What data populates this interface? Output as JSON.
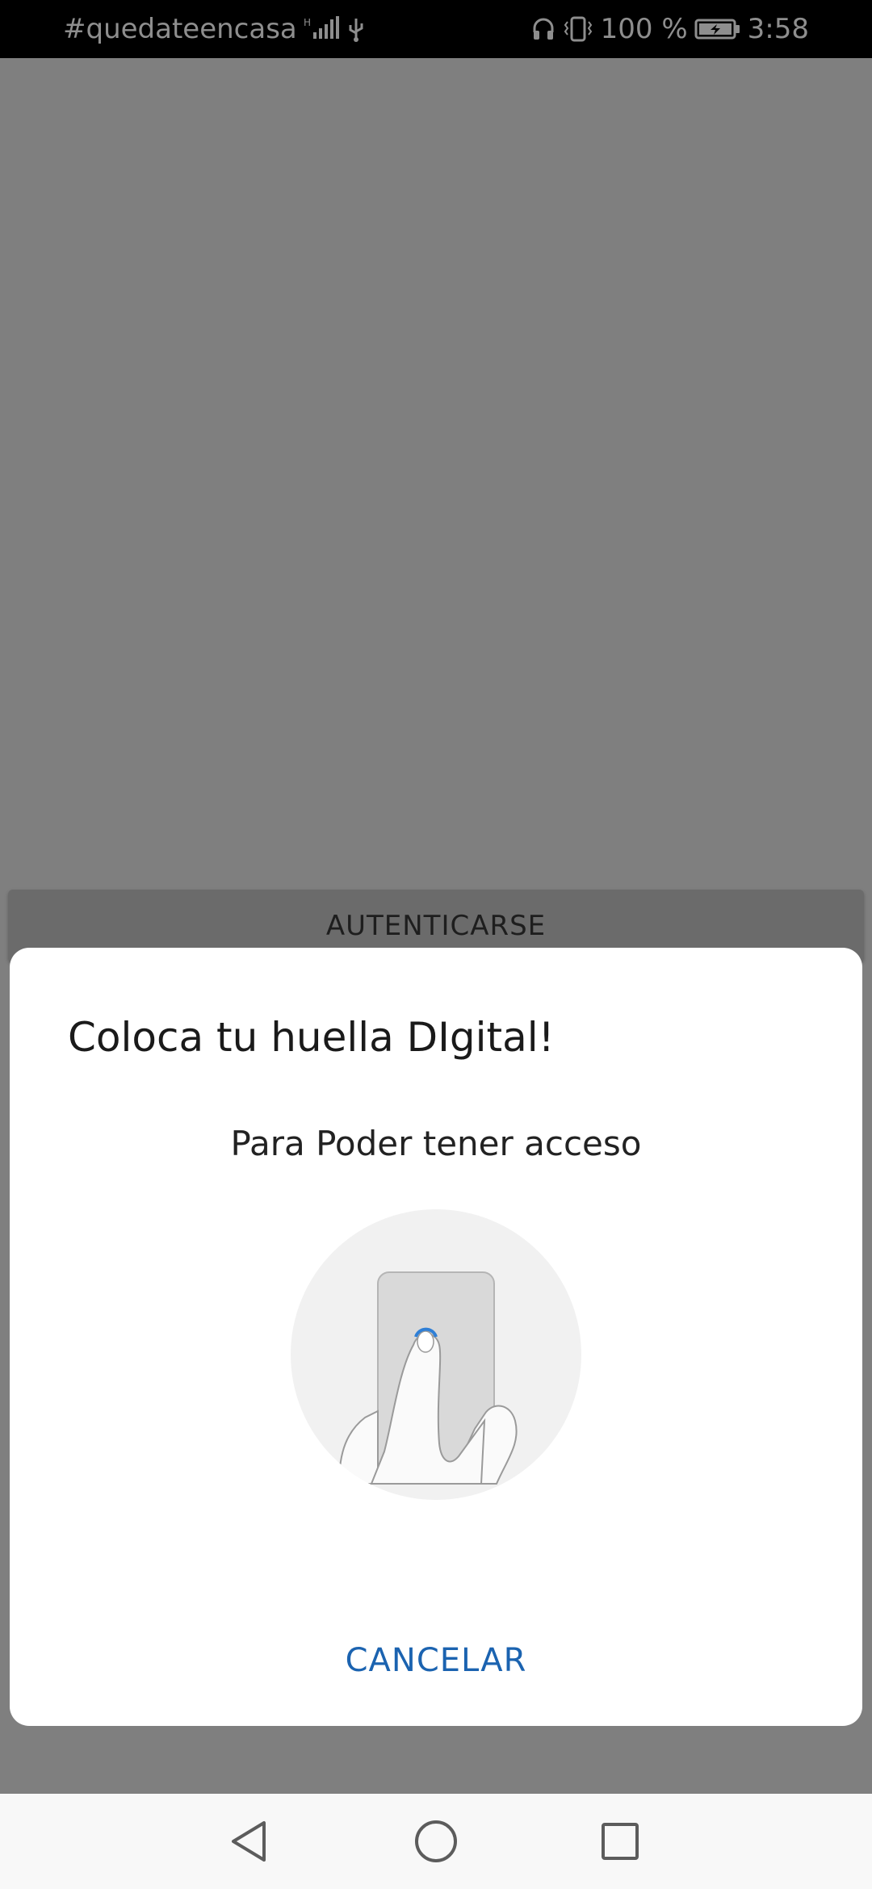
{
  "status_bar": {
    "carrier_text": "#quedateencasa",
    "battery_percent": "100 %",
    "time": "3:58",
    "icons": [
      "signal-icon",
      "usb-icon",
      "headphones-icon",
      "vibrate-icon",
      "battery-charging-icon"
    ]
  },
  "background": {
    "auth_button_label": "AUTENTICARSE"
  },
  "dialog": {
    "title": "Coloca tu huella DIgital!",
    "subtitle": "Para Poder tener acceso",
    "illustration": "fingerprint-sensor-illustration",
    "cancel_label": "CANCELAR",
    "accent_color": "#1b63b0"
  },
  "nav_bar": {
    "buttons": [
      "back-icon",
      "home-icon",
      "recents-icon"
    ]
  }
}
